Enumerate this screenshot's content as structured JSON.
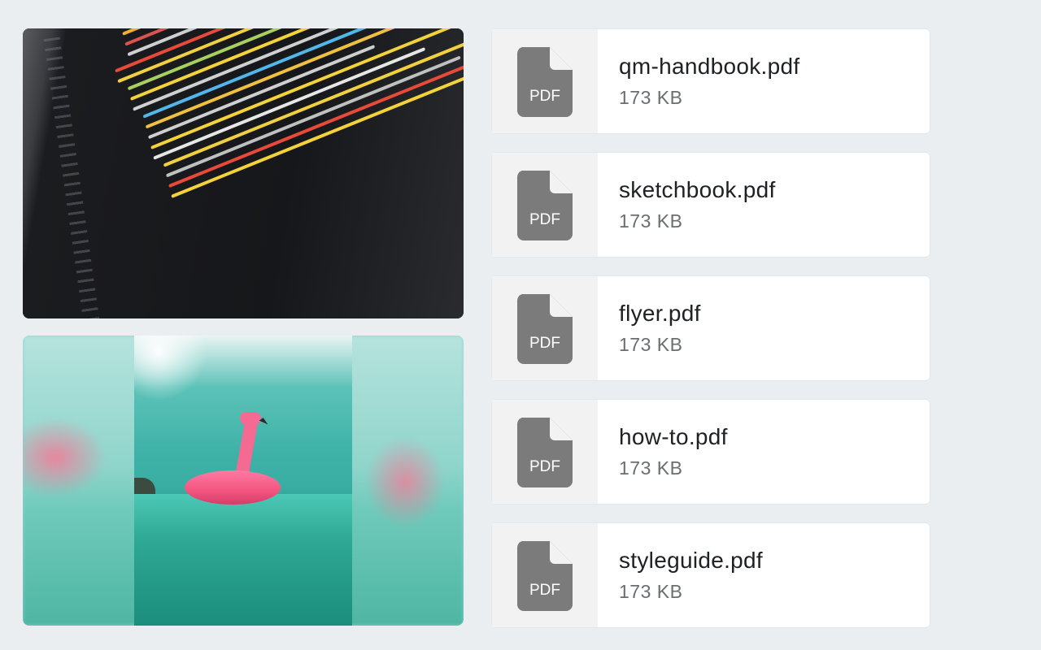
{
  "images": [
    {
      "name": "code-screenshot-image"
    },
    {
      "name": "flamingo-float-image"
    }
  ],
  "files": [
    {
      "name": "qm-handbook.pdf",
      "size": "173 KB",
      "type_label": "PDF"
    },
    {
      "name": "sketchbook.pdf",
      "size": "173 KB",
      "type_label": "PDF"
    },
    {
      "name": "flyer.pdf",
      "size": "173 KB",
      "type_label": "PDF"
    },
    {
      "name": "how-to.pdf",
      "size": "173 KB",
      "type_label": "PDF"
    },
    {
      "name": "styleguide.pdf",
      "size": "173 KB",
      "type_label": "PDF"
    }
  ],
  "colors": {
    "background": "#ebeef1",
    "card": "#ffffff",
    "icon": "#7b7b7b",
    "thumb": "#f2f2f2",
    "file_name": "#202124",
    "file_size": "#6a6d71"
  }
}
